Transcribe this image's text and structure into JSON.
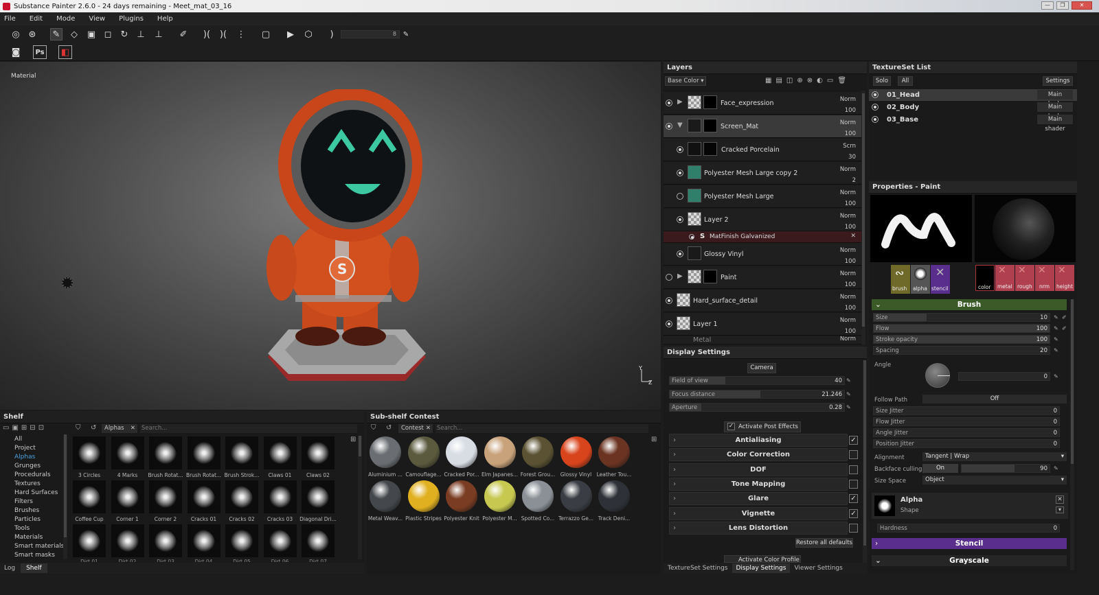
{
  "title": "Substance Painter 2.6.0 - 24 days remaining - Meet_mat_03_16",
  "window_buttons": [
    "—",
    "❐",
    "✕"
  ],
  "menu": [
    "File",
    "Edit",
    "Mode",
    "View",
    "Plugins",
    "Help"
  ],
  "toolbar": {
    "size_value": "8"
  },
  "viewport": {
    "label": "Material",
    "axis_y": "Y",
    "axis_z": "Z"
  },
  "layers": {
    "title": "Layers",
    "channel": "Base Color",
    "rows": [
      {
        "name": "Face_expression",
        "blend": "Norm",
        "opacity": "100"
      },
      {
        "name": "Screen_Mat",
        "blend": "Norm",
        "opacity": "100"
      },
      {
        "name": "Cracked Porcelain",
        "blend": "Scrn",
        "opacity": "30"
      },
      {
        "name": "Polyester Mesh Large copy 2",
        "blend": "Norm",
        "opacity": "2"
      },
      {
        "name": "Polyester Mesh Large",
        "blend": "Norm",
        "opacity": "100"
      },
      {
        "name": "Layer 2",
        "blend": "Norm",
        "opacity": "100"
      },
      {
        "name": "Glossy Vinyl",
        "blend": "Norm",
        "opacity": "100"
      },
      {
        "name": "Paint",
        "blend": "Norm",
        "opacity": "100"
      },
      {
        "name": "Hard_surface_detail",
        "blend": "Norm",
        "opacity": "100"
      },
      {
        "name": "Layer 1",
        "blend": "Norm",
        "opacity": "100"
      },
      {
        "name": "Metal",
        "blend": "Norm",
        "opacity": ""
      }
    ],
    "filter_name": "MatFinish Galvanized"
  },
  "textureset": {
    "title": "TextureSet List",
    "solo": "Solo",
    "all": "All",
    "settings": "Settings",
    "items": [
      {
        "name": "01_Head",
        "shader": "Main shader"
      },
      {
        "name": "02_Body",
        "shader": "Main shader"
      },
      {
        "name": "03_Base",
        "shader": "Main shader"
      }
    ]
  },
  "properties": {
    "title": "Properties - Paint",
    "slots": [
      "brush",
      "alpha",
      "stencil"
    ],
    "channels": [
      "color",
      "metal",
      "rough",
      "nrm",
      "height"
    ],
    "brush_header": "Brush",
    "size": {
      "label": "Size",
      "value": "10",
      "fraction": 0.3
    },
    "flow": {
      "label": "Flow",
      "value": "100",
      "fraction": 1.0
    },
    "stroke_opacity": {
      "label": "Stroke opacity",
      "value": "100",
      "fraction": 1.0
    },
    "spacing": {
      "label": "Spacing",
      "value": "20",
      "fraction": 0.0
    },
    "angle": {
      "label": "Angle",
      "value": "0"
    },
    "follow_path": {
      "label": "Follow Path",
      "value": "Off"
    },
    "size_jitter": {
      "label": "Size Jitter",
      "value": "0"
    },
    "flow_jitter": {
      "label": "Flow Jitter",
      "value": "0"
    },
    "angle_jitter": {
      "label": "Angle Jitter",
      "value": "0"
    },
    "position_jitter": {
      "label": "Position Jitter",
      "value": "0"
    },
    "alignment": {
      "label": "Alignment",
      "value": "Tangent | Wrap"
    },
    "backface": {
      "label": "Backface culling",
      "toggle": "On",
      "value": "90",
      "fraction": 0.6
    },
    "size_space": {
      "label": "Size Space",
      "value": "Object"
    },
    "alpha": {
      "title": "Alpha",
      "sub": "Shape"
    },
    "hardness": {
      "label": "Hardness",
      "value": "0"
    },
    "stencil": "Stencil",
    "grayscale": "Grayscale"
  },
  "display": {
    "title": "Display Settings",
    "camera": "Camera",
    "fov": {
      "label": "Field of view",
      "value": "40",
      "fraction": 0.32
    },
    "focus": {
      "label": "Focus distance",
      "value": "21.246",
      "fraction": 0.52
    },
    "aperture": {
      "label": "Aperture",
      "value": "0.28",
      "fraction": 0.18
    },
    "activate_post": "Activate Post Effects",
    "effects": [
      {
        "name": "Antialiasing",
        "checked": true
      },
      {
        "name": "Color Correction",
        "checked": false
      },
      {
        "name": "DOF",
        "checked": false
      },
      {
        "name": "Tone Mapping",
        "checked": false
      },
      {
        "name": "Glare",
        "checked": true
      },
      {
        "name": "Vignette",
        "checked": true
      },
      {
        "name": "Lens Distortion",
        "checked": false
      }
    ],
    "restore": "Restore all defaults",
    "activate_color": "Activate Color Profile",
    "tabs": [
      "TextureSet Settings",
      "Display Settings",
      "Viewer Settings"
    ]
  },
  "shelf": {
    "title": "Shelf",
    "filter": "Alphas",
    "search": "Search...",
    "categories": [
      "All",
      "Project",
      "Alphas",
      "Grunges",
      "Procedurals",
      "Textures",
      "Hard Surfaces",
      "Filters",
      "Brushes",
      "Particles",
      "Tools",
      "Materials",
      "Smart materials",
      "Smart masks"
    ],
    "items": [
      "3 Circles",
      "4 Marks",
      "Brush Rotat...",
      "Brush Rotat...",
      "Brush Strok...",
      "Claws 01",
      "Claws 02",
      "Coffee Cup",
      "Corner 1",
      "Corner 2",
      "Cracks 01",
      "Cracks 02",
      "Cracks 03",
      "Diagonal Dri...",
      "Dirt 01",
      "Dirt 02",
      "Dirt 03",
      "Dirt 04",
      "Dirt 05",
      "Dirt 06",
      "Dirt 07"
    ],
    "tabs": [
      "Log",
      "Shelf"
    ]
  },
  "subshelf": {
    "title": "Sub-shelf Contest",
    "filter": "Contest",
    "search": "Search...",
    "items": [
      {
        "name": "Aluminium ...",
        "color": "#6a6e72"
      },
      {
        "name": "Camouflage...",
        "color": "#5b5a3e"
      },
      {
        "name": "Cracked Por...",
        "color": "#d8dde4"
      },
      {
        "name": "Elm Japanes...",
        "color": "#c8a27a"
      },
      {
        "name": "Forest Grou...",
        "color": "#5a5232"
      },
      {
        "name": "Glossy Vinyl",
        "color": "#d8441c"
      },
      {
        "name": "Leather Tou...",
        "color": "#6b3422"
      },
      {
        "name": "Metal Weav...",
        "color": "#44484c"
      },
      {
        "name": "Plastic Stripes",
        "color": "#e0b020"
      },
      {
        "name": "Polyester Knit",
        "color": "#7a3c22"
      },
      {
        "name": "Polyester M...",
        "color": "#c6c850"
      },
      {
        "name": "Spotted Co...",
        "color": "#8a9096"
      },
      {
        "name": "Terrazzo Ge...",
        "color": "#3a3e44"
      },
      {
        "name": "Track Deni...",
        "color": "#2e3238"
      }
    ]
  },
  "colors": {
    "accent_purple": "#5a2e8c",
    "header_green": "#3c5a28",
    "teal": "#3cc8a0",
    "orange": "#d8441c"
  }
}
